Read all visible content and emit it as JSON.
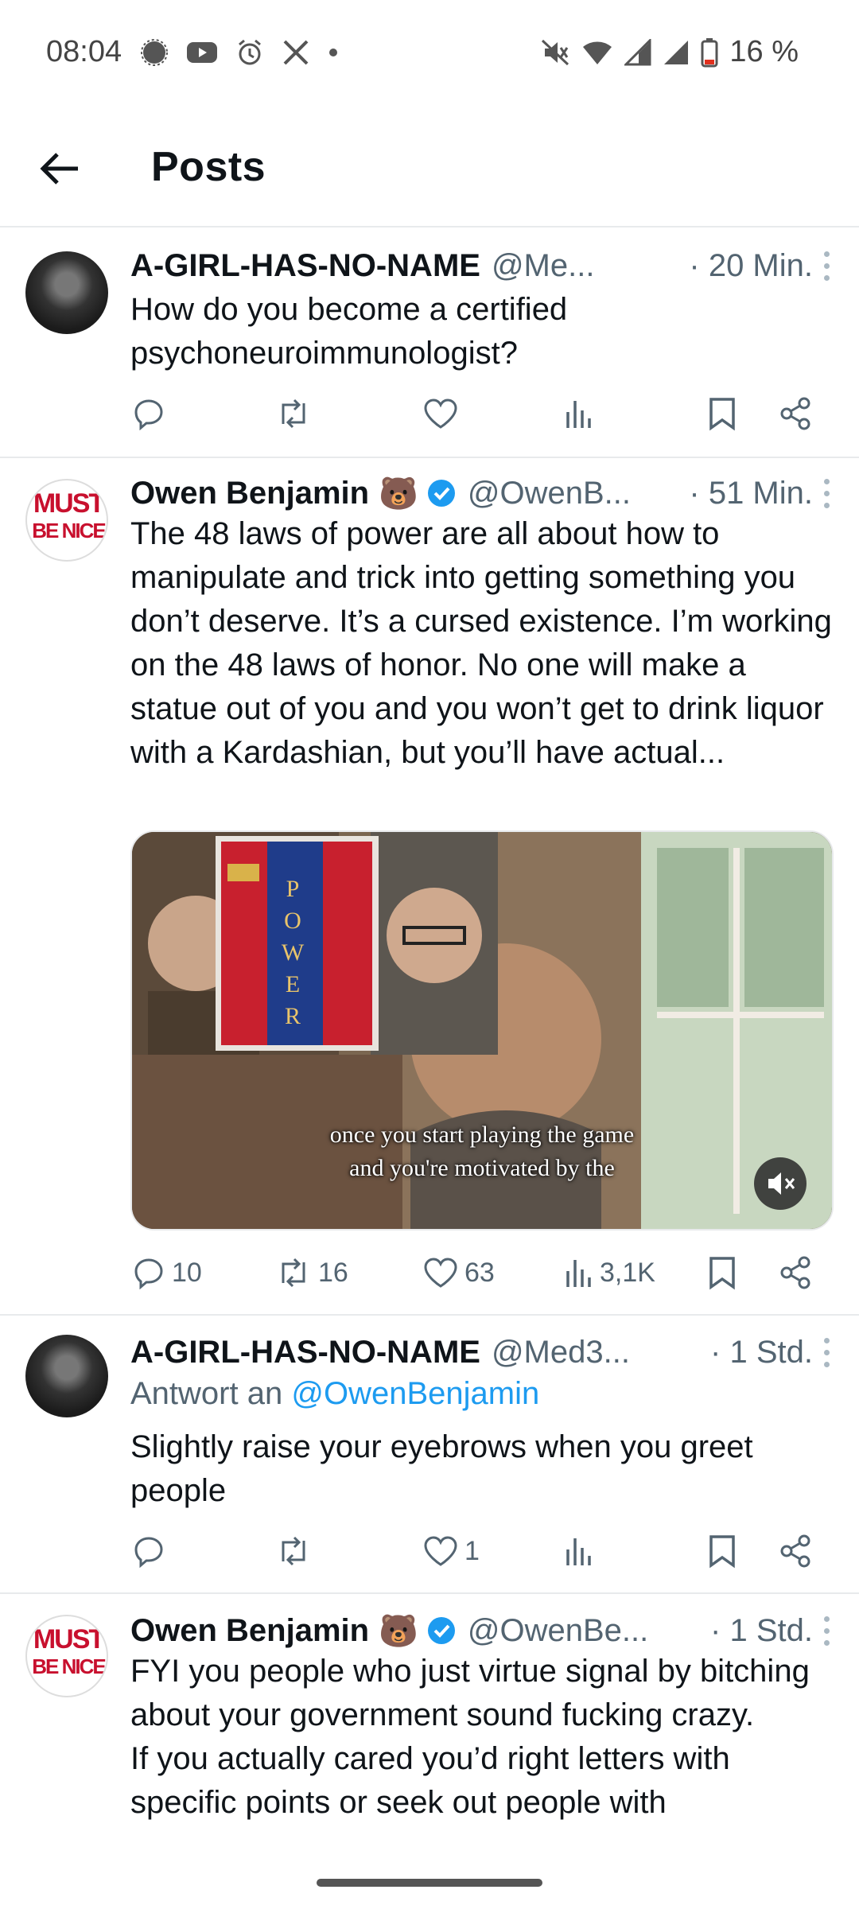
{
  "status_bar": {
    "time": "08:04",
    "battery": "16 %"
  },
  "header": {
    "title": "Posts"
  },
  "posts": [
    {
      "name": "A-GIRL-HAS-NO-NAME",
      "handle": "@Me...",
      "time": "· 20 Min.",
      "text": "How do you become a certified psychoneuroimmunologist?",
      "replies": "",
      "reposts": "",
      "likes": "",
      "views": ""
    },
    {
      "name": "Owen Benjamin",
      "emoji": "🐻",
      "handle": "@OwenB...",
      "time": "· 51 Min.",
      "text": "The 48 laws of power are all about how to manipulate and trick into getting something you don’t deserve. It’s a cursed existence. I’m working on the 48 laws of honor. No one will make a statue out of you and you won’t get to drink liquor with a Kardashian, but you’ll have actual...",
      "media": {
        "book_letters": [
          "P",
          "O",
          "W",
          "E",
          "R"
        ],
        "caption_line1": "once you start playing the game",
        "caption_line2": "and you're motivated by the"
      },
      "replies": "10",
      "reposts": "16",
      "likes": "63",
      "views": "3,1K"
    },
    {
      "name": "A-GIRL-HAS-NO-NAME",
      "handle": "@Med3...",
      "time": "· 1 Std.",
      "reply_prefix": "Antwort an",
      "reply_to": "@OwenBenjamin",
      "text": "Slightly raise your eyebrows when you greet people",
      "replies": "",
      "reposts": "",
      "likes": "1",
      "views": ""
    },
    {
      "name": "Owen Benjamin",
      "emoji": "🐻",
      "handle": "@OwenBe...",
      "time": "· 1 Std.",
      "text_line1": "FYI you people who just virtue signal by bitching about your government sound fucking crazy.",
      "text_line2": "If you actually cared you’d right letters with specific points or seek out people with"
    }
  ],
  "avatar_text": {
    "line1": "MUST",
    "line2": "BE NICE"
  },
  "colors": {
    "accent": "#1d9bf0",
    "muted": "#536471",
    "text": "#0f1419",
    "divider": "#e8eaec"
  }
}
